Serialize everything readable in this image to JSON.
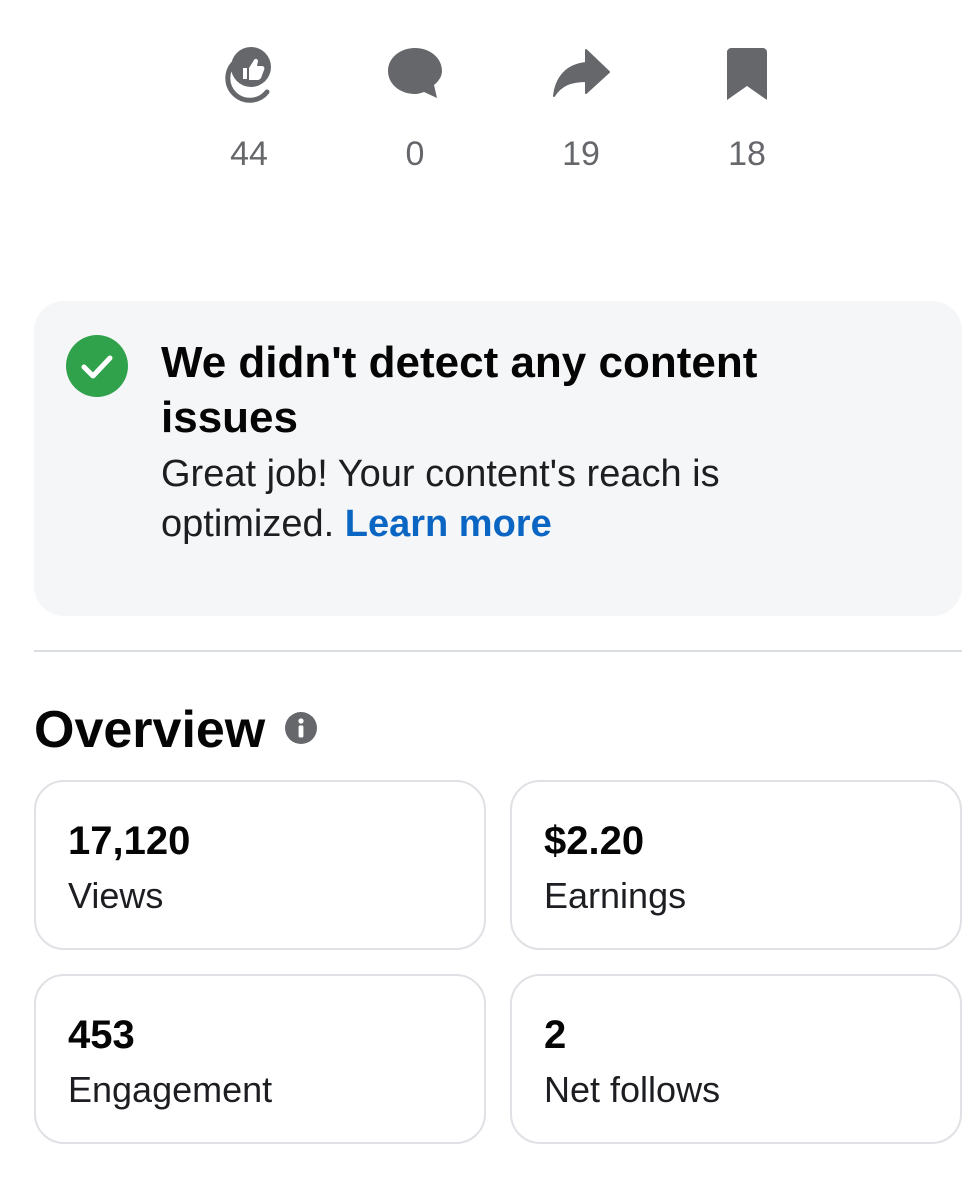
{
  "stats": [
    {
      "icon": "like-icon",
      "count": "44"
    },
    {
      "icon": "comment-icon",
      "count": "0"
    },
    {
      "icon": "share-icon",
      "count": "19"
    },
    {
      "icon": "bookmark-icon",
      "count": "18"
    }
  ],
  "notice": {
    "icon": "check-circle-icon",
    "title": "We didn't detect any content issues",
    "description": "Great job! Your content's reach is optimized.",
    "link_label": "Learn more"
  },
  "overview": {
    "title": "Overview",
    "info_icon": "info-icon",
    "cards": [
      {
        "value": "17,120",
        "label": "Views"
      },
      {
        "value": "$2.20",
        "label": "Earnings"
      },
      {
        "value": "453",
        "label": "Engagement"
      },
      {
        "value": "2",
        "label": "Net follows"
      }
    ]
  },
  "colors": {
    "icon_gray": "#65676b",
    "check_green": "#31a24c",
    "link_blue": "#0a66c2",
    "notice_bg": "#f5f6f8"
  }
}
